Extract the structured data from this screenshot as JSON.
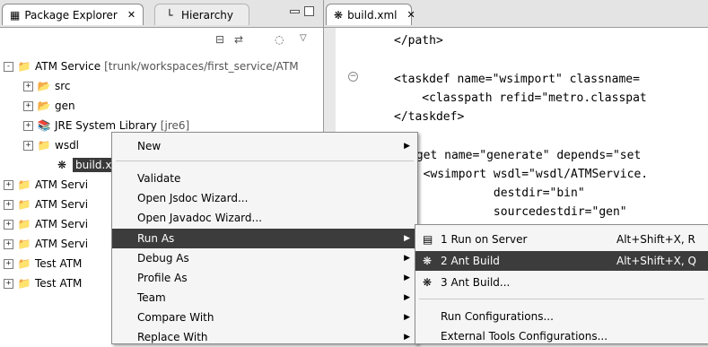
{
  "left_panel": {
    "tabs": [
      {
        "label": "Package Explorer",
        "icon": "package-explorer-icon"
      },
      {
        "label": "Hierarchy",
        "icon": "hierarchy-icon"
      }
    ],
    "toolbar_icons": [
      "collapse-all-icon",
      "link-with-editor-icon",
      "focus-icon",
      "view-menu-icon"
    ],
    "tree": [
      {
        "label": "ATM Service",
        "decoration": "[trunk/workspaces/first_service/ATM",
        "icon": "project-icon",
        "expander": "-"
      },
      {
        "label": "src",
        "icon": "source-folder-icon",
        "expander": "+"
      },
      {
        "label": "gen",
        "icon": "source-folder-icon",
        "expander": "+"
      },
      {
        "label": "JRE System Library",
        "decoration": "[jre6]",
        "icon": "library-icon",
        "expander": "+"
      },
      {
        "label": "wsdl",
        "icon": "folder-icon",
        "expander": "+"
      },
      {
        "label": "build.x",
        "icon": "ant-file-icon",
        "expander": ""
      },
      {
        "label": "ATM Servi",
        "icon": "project-icon",
        "expander": "+"
      },
      {
        "label": "ATM Servi",
        "icon": "project-icon",
        "expander": "+"
      },
      {
        "label": "ATM Servi",
        "icon": "project-icon",
        "expander": "+"
      },
      {
        "label": "ATM Servi",
        "icon": "project-icon",
        "expander": "+"
      },
      {
        "label": "Test ATM",
        "icon": "project-icon",
        "expander": "+"
      },
      {
        "label": "Test ATM",
        "icon": "project-icon",
        "expander": "+"
      }
    ]
  },
  "editor": {
    "tab": {
      "label": "build.xml",
      "icon": "ant-file-icon"
    },
    "code_lines": [
      "</path>",
      "",
      "<taskdef name=\"wsimport\" classname=",
      "    <classpath refid=\"metro.classpat",
      "</taskdef>",
      "",
      "rget name=\"generate\" depends=\"set",
      "  <wsimport wsdl=\"wsdl/ATMService.",
      "            destdir=\"bin\"",
      "            sourcedestdir=\"gen\""
    ]
  },
  "context_menu": {
    "items": [
      "New",
      "Validate",
      "Open Jsdoc Wizard...",
      "Open Javadoc Wizard...",
      "Run As",
      "Debug As",
      "Profile As",
      "Team",
      "Compare With",
      "Replace With"
    ],
    "highlighted": "Run As"
  },
  "run_as_submenu": {
    "items": [
      {
        "label": "1 Run on Server",
        "accel": "Alt+Shift+X, R",
        "icon": "server-icon"
      },
      {
        "label": "2 Ant Build",
        "accel": "Alt+Shift+X, Q",
        "icon": "ant-icon"
      },
      {
        "label": "3 Ant Build...",
        "accel": "",
        "icon": "ant-icon"
      },
      {
        "label": "Run Configurations...",
        "accel": "",
        "icon": ""
      },
      {
        "label": "External Tools Configurations...",
        "accel": "",
        "icon": ""
      }
    ],
    "highlighted": "2 Ant Build"
  }
}
